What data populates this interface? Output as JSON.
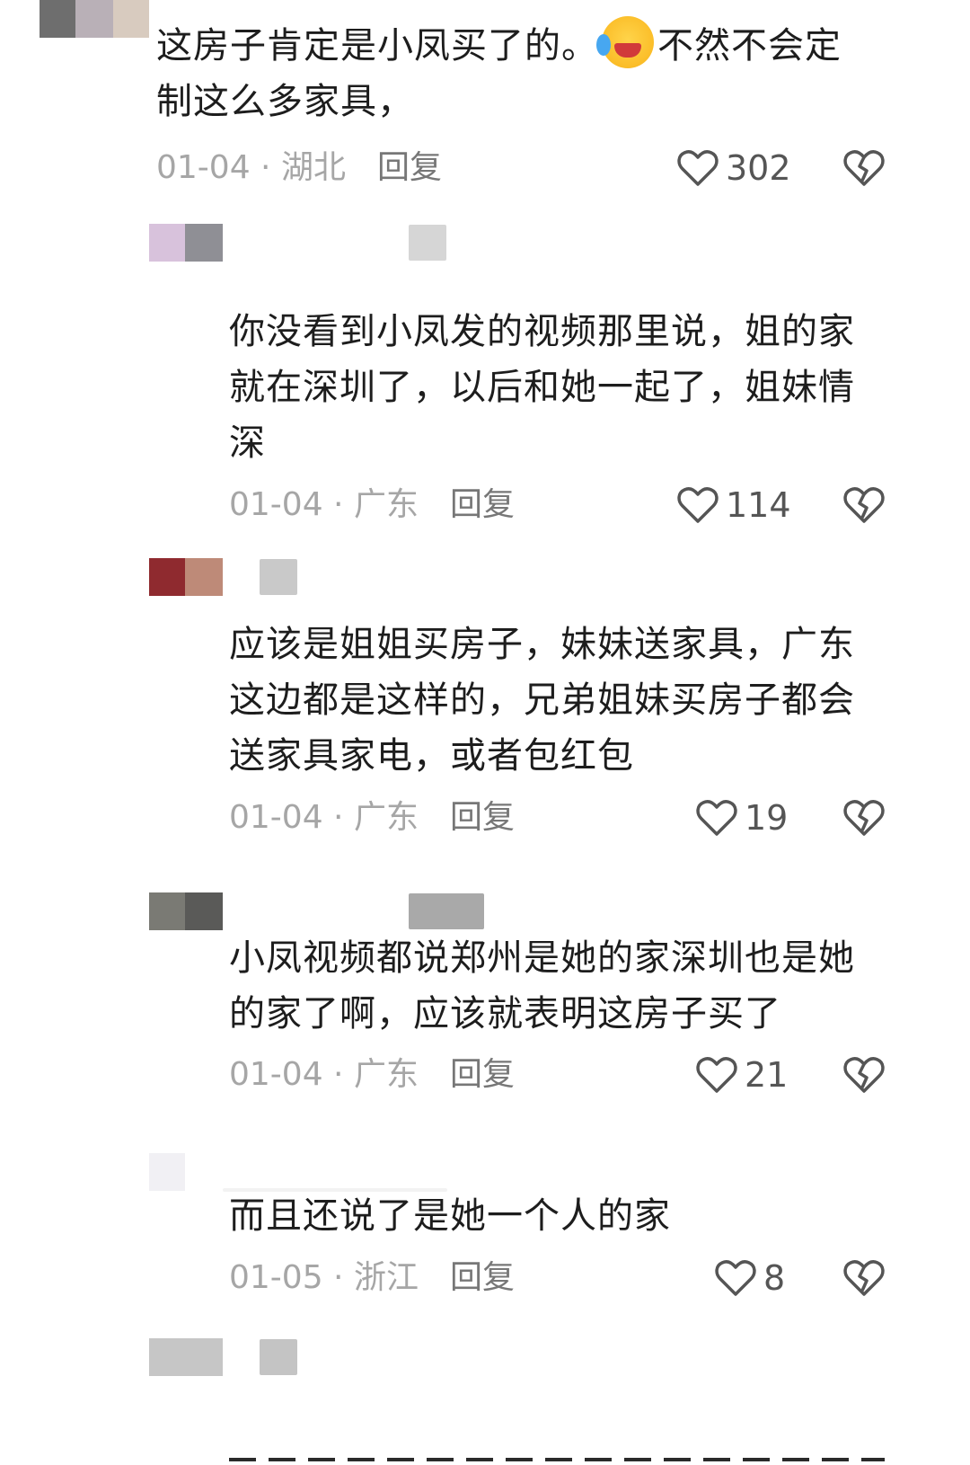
{
  "comments": [
    {
      "text_lines": [
        "这房子肯定是小凤买了的。",
        "不然不会定",
        "制这么多家具，"
      ],
      "emoji": "crying-laughing-emoji",
      "date_region": "01-04 · 湖北",
      "reply_label": "回复",
      "likes": "302"
    },
    {
      "text_lines": [
        "你没看到小凤发的视频那里说，姐的家",
        "就在深圳了，以后和她一起了，姐妹情",
        "深"
      ],
      "date_region": "01-04 · 广东",
      "reply_label": "回复",
      "likes": "114"
    },
    {
      "text_lines": [
        "应该是姐姐买房子，妹妹送家具，广东",
        "这边都是这样的，兄弟姐妹买房子都会",
        "送家具家电，或者包红包"
      ],
      "date_region": "01-04 · 广东",
      "reply_label": "回复",
      "likes": "19"
    },
    {
      "text_lines": [
        "小凤视频都说郑州是她的家深圳也是她",
        "的家了啊，应该就表明这房子买了"
      ],
      "date_region": "01-04 · 广东",
      "reply_label": "回复",
      "likes": "21"
    },
    {
      "text_lines": [
        "而且还说了是她一个人的家"
      ],
      "date_region": "01-05 · 浙江",
      "reply_label": "回复",
      "likes": "8"
    }
  ],
  "icons": {
    "like": "heart-outline-icon",
    "dislike": "broken-heart-icon"
  },
  "colors": {
    "meta": "#a6a6a6",
    "reply": "#777777",
    "icon": "#555555"
  }
}
